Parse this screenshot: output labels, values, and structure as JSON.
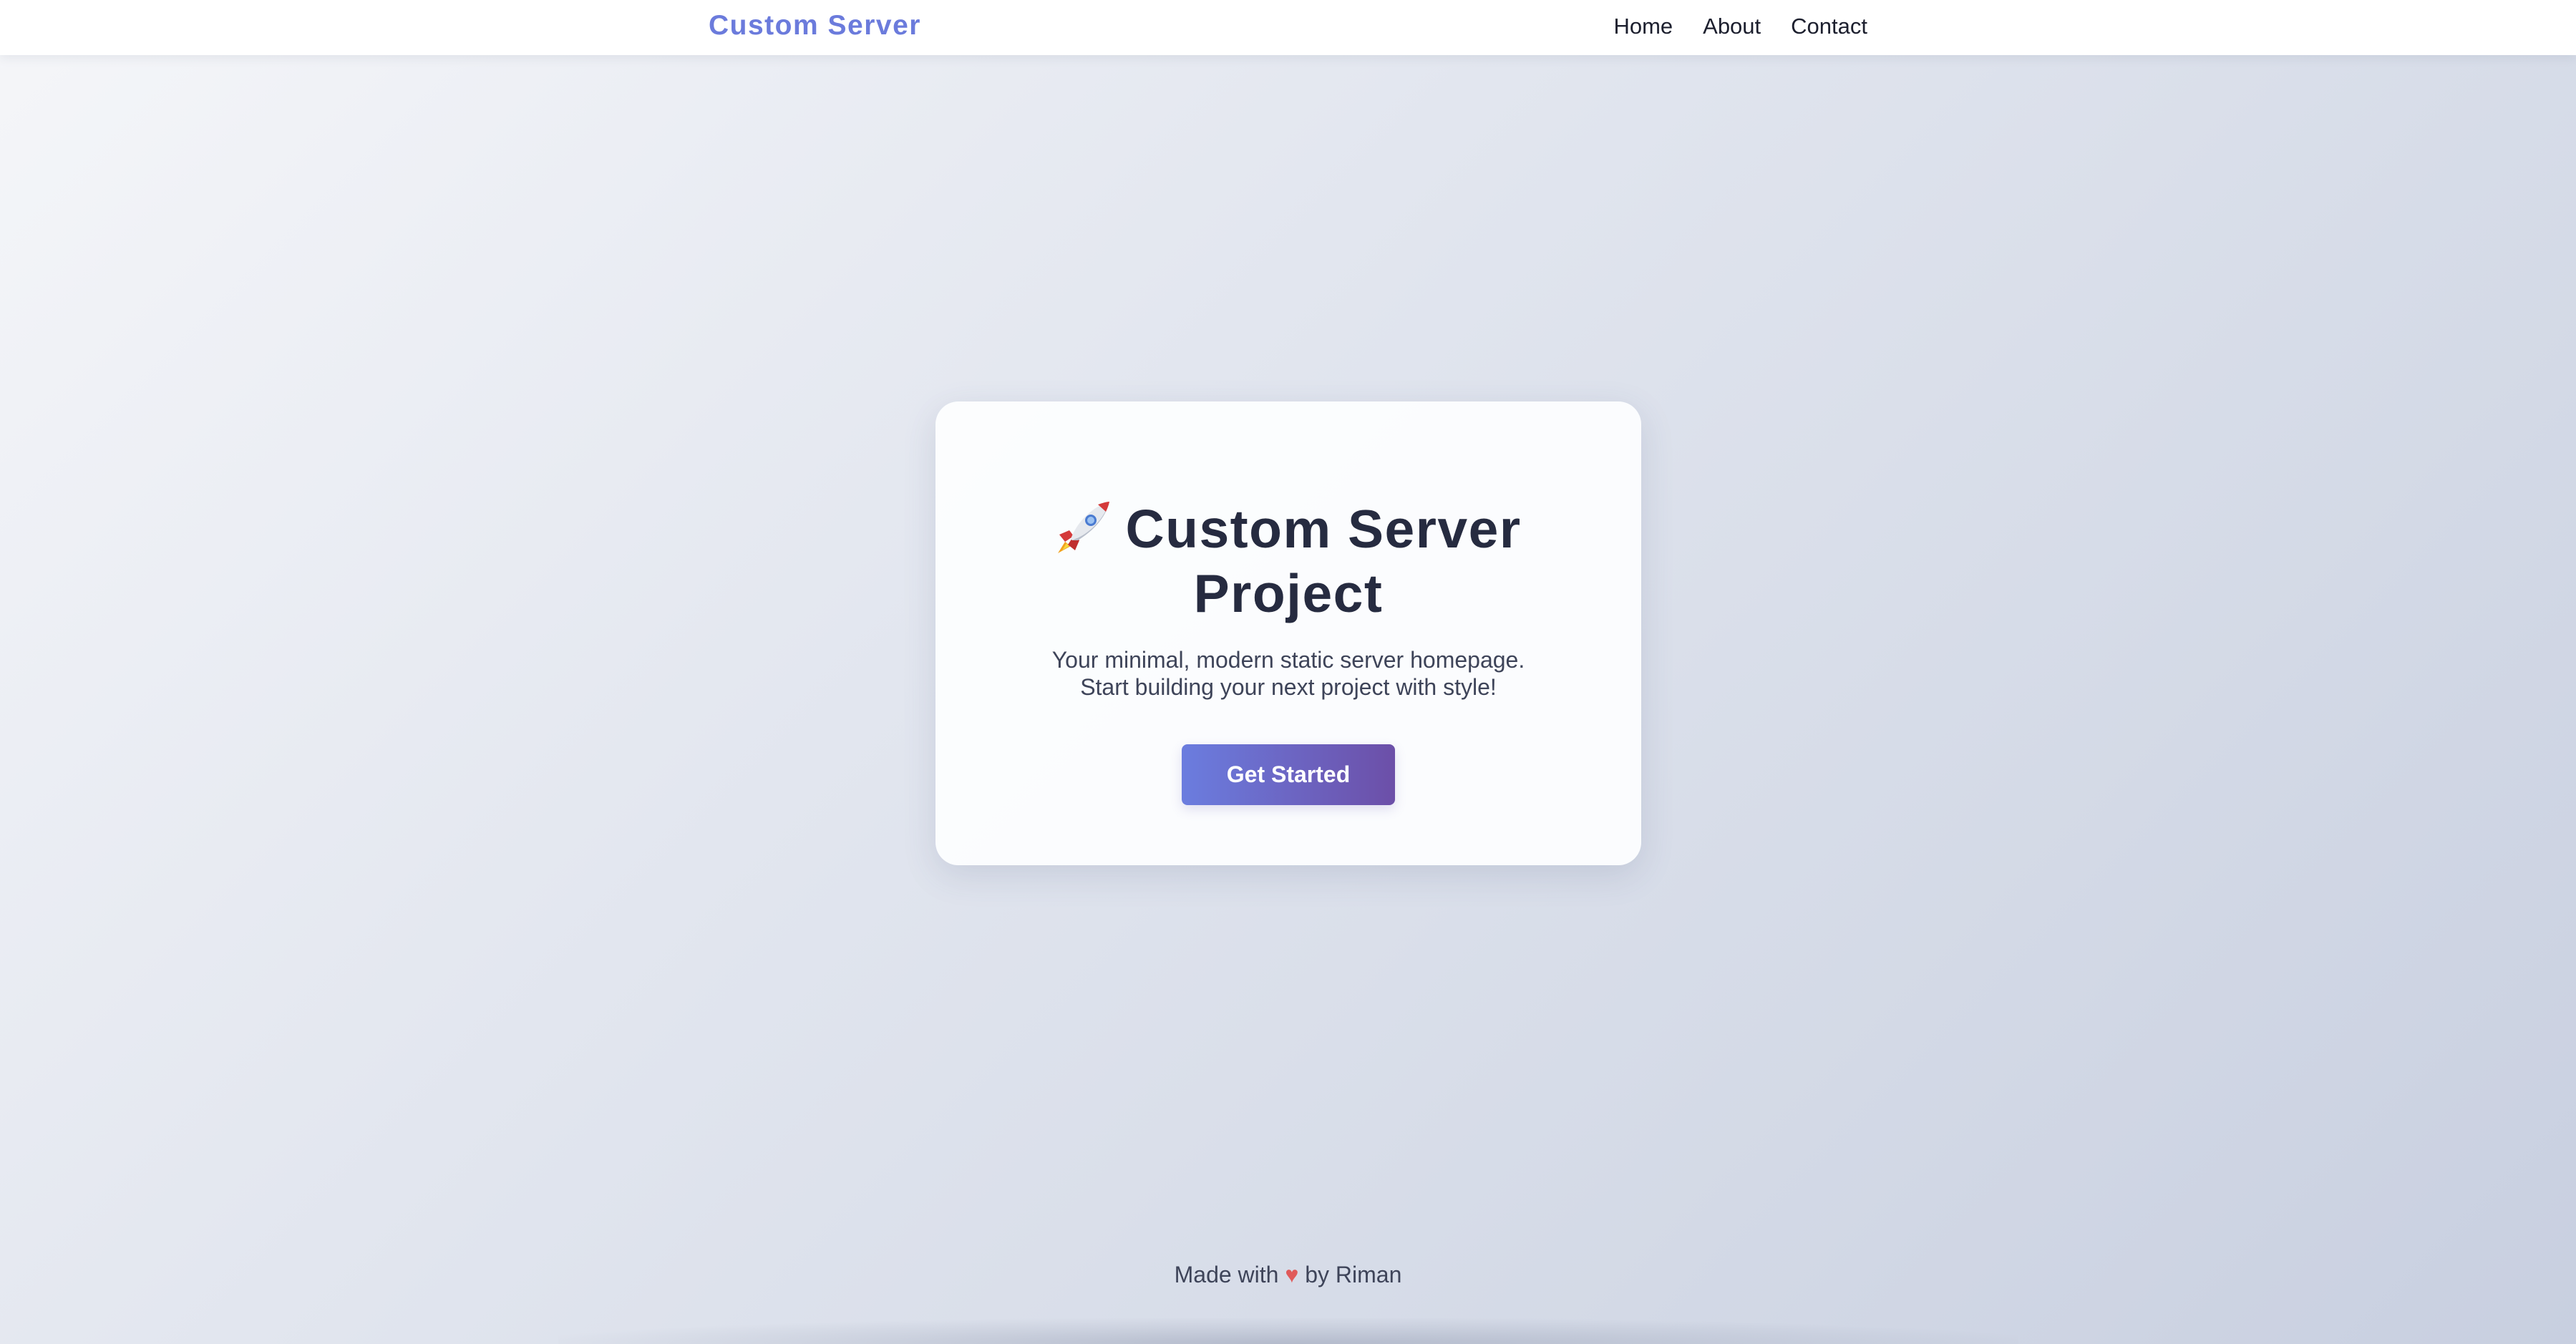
{
  "nav": {
    "brand": "Custom Server",
    "links": [
      {
        "label": "Home"
      },
      {
        "label": "About"
      },
      {
        "label": "Contact"
      }
    ]
  },
  "hero": {
    "icon": "rocket-emoji",
    "title_line1": "Custom Server",
    "title_line2": "Project",
    "subtitle_line1": "Your minimal, modern static server homepage.",
    "subtitle_line2": "Start building your next project with style!",
    "cta_label": "Get Started"
  },
  "footer": {
    "prefix": "Made with",
    "heart": "♥",
    "suffix": "by Riman"
  },
  "colors": {
    "brand": "#6b7bdc",
    "button_start": "#6b7ddf",
    "button_end": "#6c4fa8",
    "heart": "#e05a5a",
    "title": "#262b40"
  }
}
